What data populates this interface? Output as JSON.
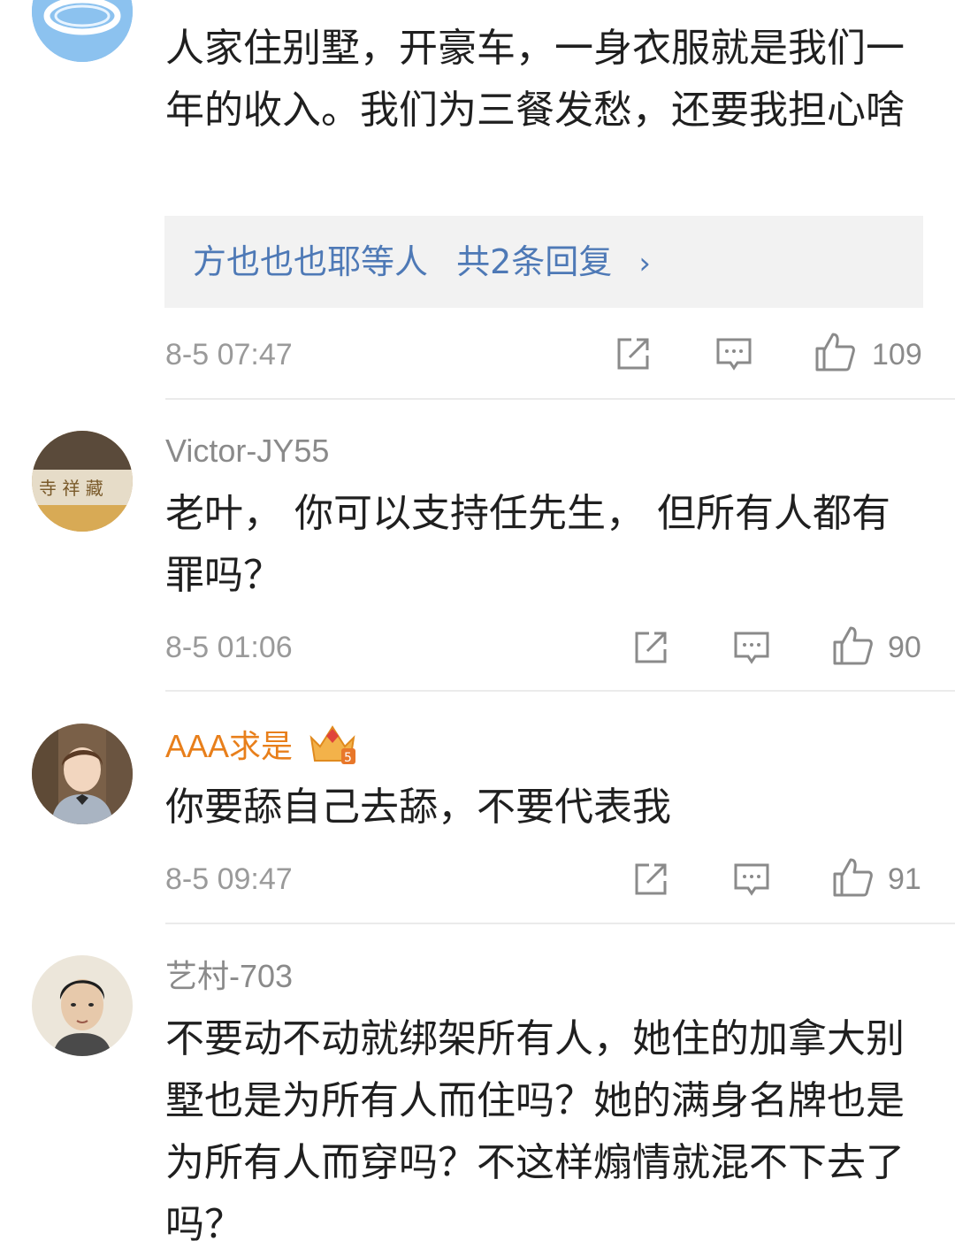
{
  "comments": [
    {
      "username": "",
      "text": "人家住别墅，开豪车，一身衣服就是我们一年的收入。我们为三餐发愁，还要我担心啥",
      "reply_summary": {
        "names": "方也也也耶等人",
        "count_text": "共2条回复"
      },
      "time": "8-5 07:47",
      "likes": "109",
      "avatar_icon": "cloud-ring-avatar-icon"
    },
    {
      "username": "Victor-JY55",
      "text": "老叶， 你可以支持任先生， 但所有人都有罪吗？",
      "time": "8-5 01:06",
      "likes": "90",
      "avatar_icon": "calligraphy-plaque-avatar-icon"
    },
    {
      "username": "AAA求是",
      "badge_icon": "vip-crown-badge-icon",
      "text": "你要舔自己去舔，不要代表我",
      "time": "8-5 09:47",
      "likes": "91",
      "avatar_icon": "boy-portrait-avatar-icon"
    },
    {
      "username": "艺村-703",
      "text": "不要动不动就绑架所有人，她住的加拿大别墅也是为所有人而住吗？她的满身名牌也是为所有人而穿吗？不这样煽情就混不下去了吗？",
      "avatar_icon": "vintage-portrait-avatar-icon"
    }
  ],
  "actions": {
    "icons": [
      "share-icon",
      "comment-icon",
      "like-icon"
    ]
  },
  "colors": {
    "reply_link": "#4e79b6",
    "vip_name": "#e87f1b",
    "meta_gray": "#9a9a9a"
  }
}
